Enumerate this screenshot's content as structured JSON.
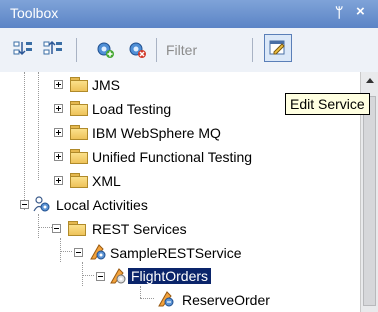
{
  "window": {
    "title": "Toolbox",
    "pin_glyph": "ᛘ",
    "close_glyph": "×"
  },
  "toolbar": {
    "filter_placeholder": "Filter",
    "buttons": [
      "sort-ascending-icon",
      "sort-descending-icon",
      "add-service-icon",
      "remove-service-icon",
      "edit-service-icon"
    ],
    "edit_tooltip": "Edit Service"
  },
  "tree": {
    "folders": [
      {
        "label": "JMS",
        "expanded": false
      },
      {
        "label": "Load Testing",
        "expanded": false
      },
      {
        "label": "IBM WebSphere MQ",
        "expanded": false
      },
      {
        "label": "Unified Functional Testing",
        "expanded": false
      },
      {
        "label": "XML",
        "expanded": false
      }
    ],
    "local_activities": {
      "label": "Local Activities",
      "rest_services": {
        "label": "REST Services",
        "service": {
          "label": "SampleRESTService",
          "resource": {
            "label": "FlightOrders",
            "selected": true,
            "children": [
              {
                "label": "ReserveOrder"
              }
            ]
          }
        }
      }
    }
  },
  "colors": {
    "titlebar": "#6b91cf",
    "selection": "#0a246a",
    "tooltip_bg": "#ffffe1"
  }
}
